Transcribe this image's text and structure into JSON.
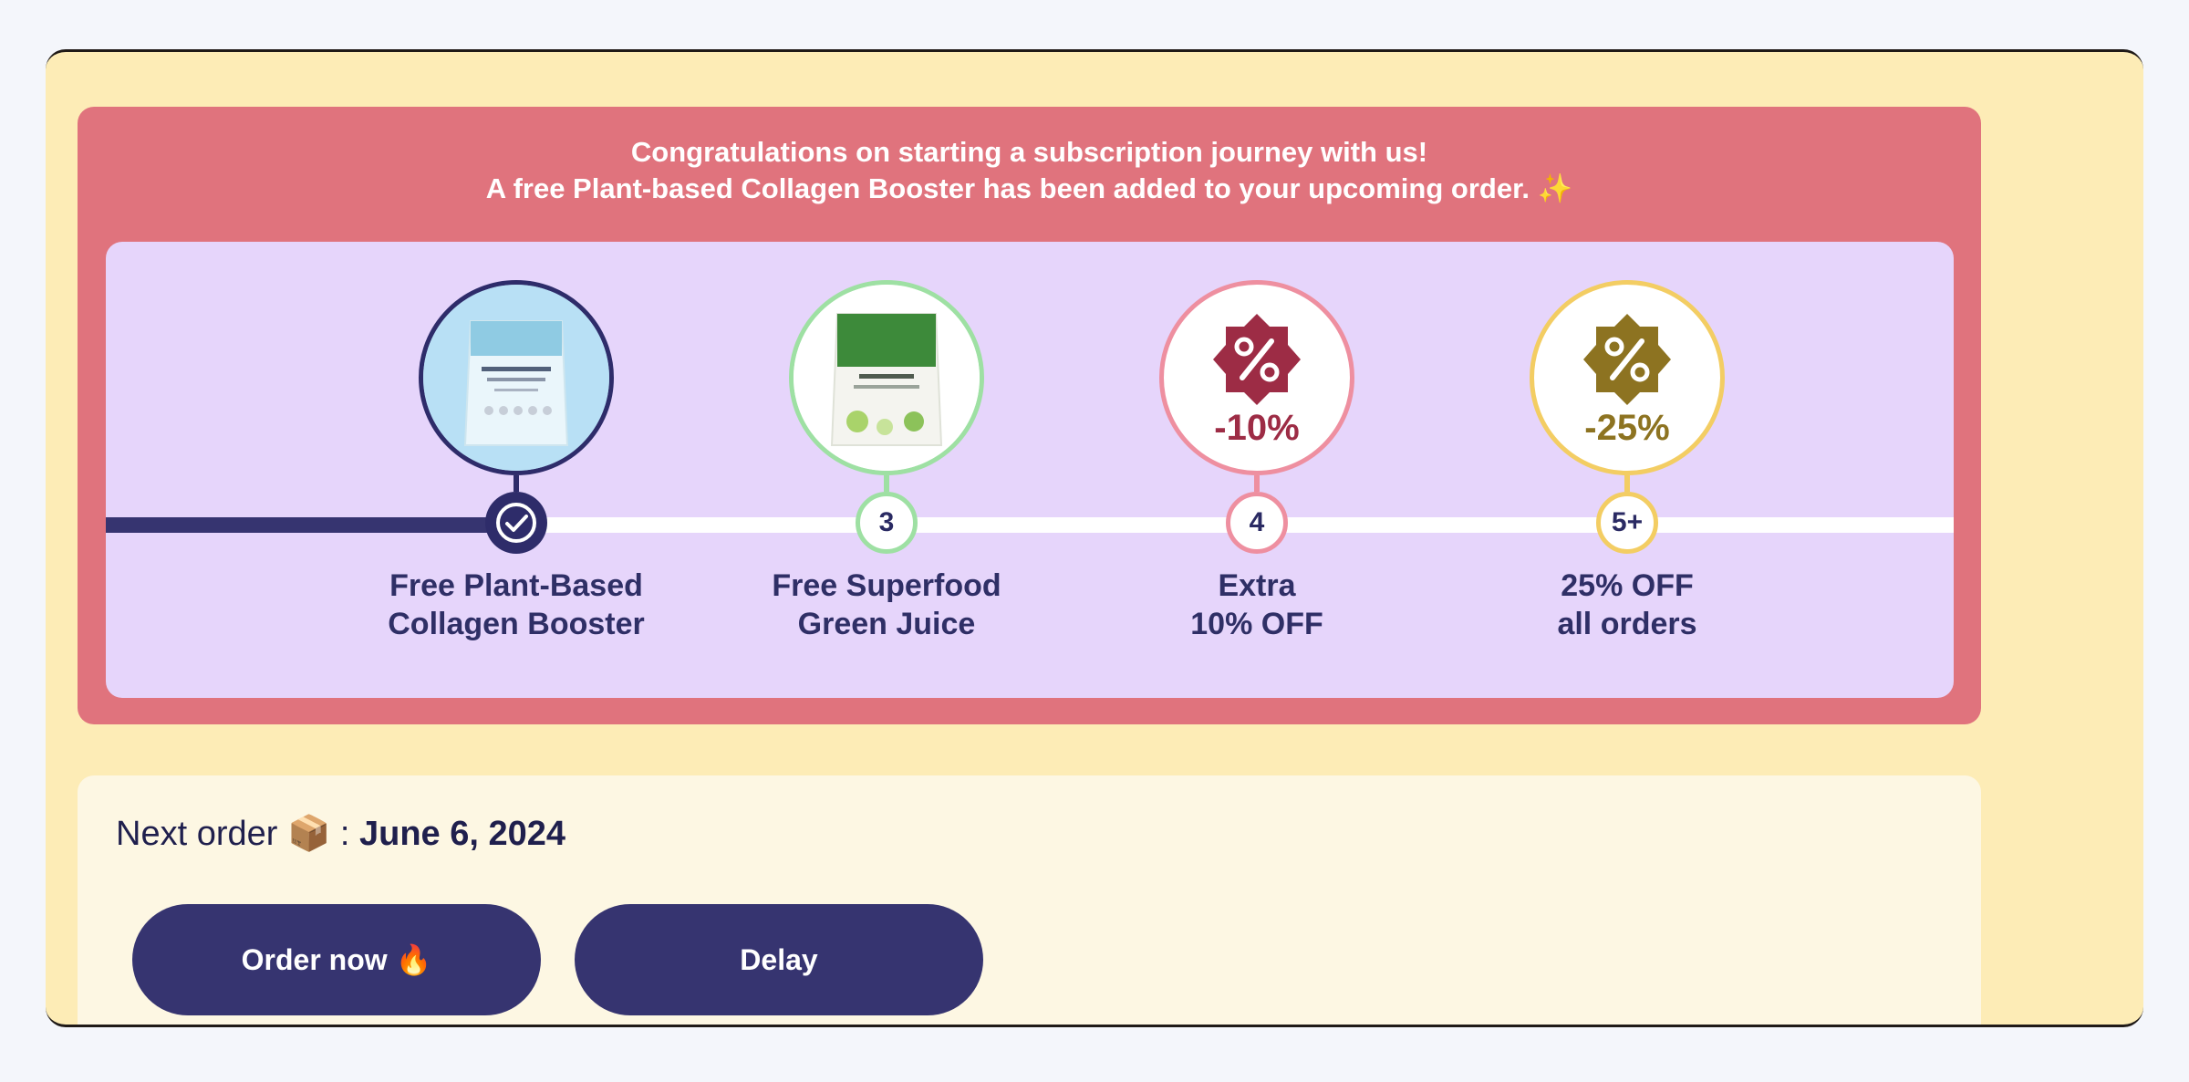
{
  "banner": {
    "line1": "Congratulations on starting a subscription journey with us!",
    "line2": "A free Plant-based Collagen Booster has been added to your upcoming order.",
    "sparkle": "✨"
  },
  "milestones": [
    {
      "step": "✓",
      "label1": "Free Plant-Based",
      "label2": "Collagen Booster",
      "completed": true,
      "ring_color": "#2e2c6a",
      "product_color": "#bfe1f6"
    },
    {
      "step": "3",
      "label1": "Free Superfood",
      "label2": "Green Juice",
      "completed": false,
      "ring_color": "#9ee0a3",
      "product_color": "#3d8a3a"
    },
    {
      "step": "4",
      "label1": "Extra",
      "label2": "10% OFF",
      "completed": false,
      "ring_color": "#ee8fa0",
      "badge_text": "-10%",
      "badge_color": "#9d2c45"
    },
    {
      "step": "5+",
      "label1": "25% OFF",
      "label2": "all orders",
      "completed": false,
      "ring_color": "#f3cd63",
      "badge_text": "-25%",
      "badge_color": "#8d7321"
    }
  ],
  "next_order": {
    "label": "Next order",
    "icon": "📦",
    "separator": " : ",
    "date": "June 6, 2024"
  },
  "buttons": {
    "order_now": "Order now",
    "order_now_icon": "🔥",
    "delay": "Delay"
  },
  "colors": {
    "primary": "#363470",
    "banner": "#e0737d",
    "track": "#e6d5fb",
    "page": "#fdecb6"
  }
}
